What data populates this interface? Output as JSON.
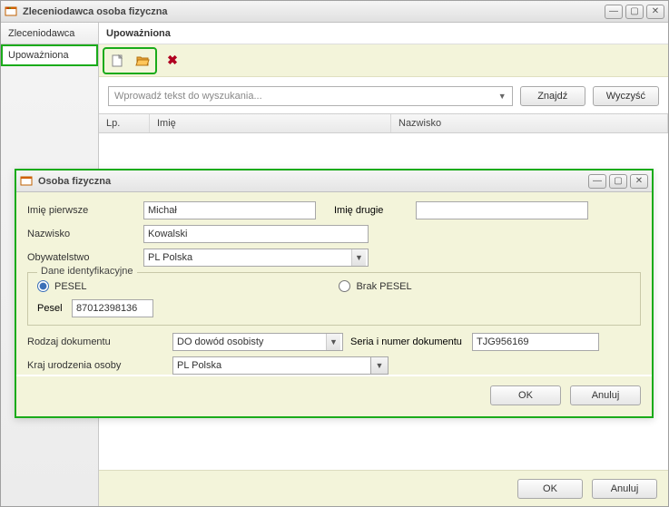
{
  "mainWindow": {
    "title": "Zleceniodawca osoba fizyczna"
  },
  "sidebar": {
    "tabs": [
      {
        "label": "Zleceniodawca"
      },
      {
        "label": "Upoważniona"
      }
    ]
  },
  "panel": {
    "header": "Upoważniona",
    "search": {
      "placeholder": "Wprowadź tekst do wyszukania...",
      "findLabel": "Znajdź",
      "clearLabel": "Wyczyść"
    },
    "columns": {
      "lp": "Lp.",
      "imie": "Imię",
      "nazwisko": "Nazwisko"
    },
    "footer": {
      "ok": "OK",
      "cancel": "Anuluj"
    }
  },
  "dialog": {
    "title": "Osoba fizyczna",
    "labels": {
      "imiePierwsze": "Imię pierwsze",
      "imieDrugie": "Imię drugie",
      "nazwisko": "Nazwisko",
      "obywatelstwo": "Obywatelstwo",
      "daneIdent": "Dane identyfikacyjne",
      "peselRadio": "PESEL",
      "brakPeselRadio": "Brak PESEL",
      "peselLabel": "Pesel",
      "rodzajDok": "Rodzaj dokumentu",
      "seriaNumer": "Seria i numer dokumentu",
      "krajUrodzenia": "Kraj urodzenia osoby"
    },
    "values": {
      "imiePierwsze": "Michał",
      "imieDrugie": "",
      "nazwisko": "Kowalski",
      "obywatelstwo": "PL Polska",
      "pesel": "87012398136",
      "rodzajDok": "DO dowód osobisty",
      "seriaNumer": "TJG956169",
      "krajUrodzenia": "PL Polska"
    },
    "footer": {
      "ok": "OK",
      "cancel": "Anuluj"
    }
  }
}
